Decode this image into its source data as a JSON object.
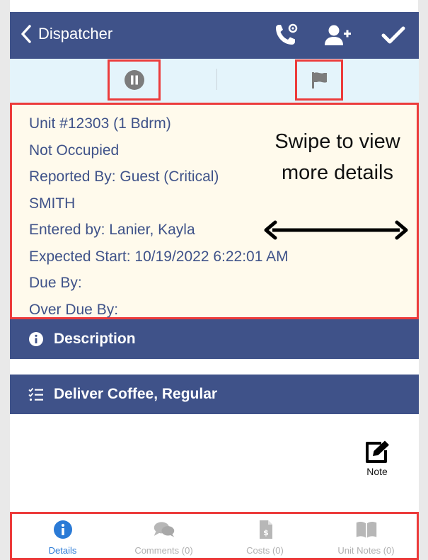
{
  "header": {
    "back_label": "Dispatcher",
    "icons": [
      "phone-icon",
      "add-user-icon",
      "checkmark-icon"
    ]
  },
  "status_bar": {
    "pause_icon": "pause-icon",
    "flag_icon": "flag-icon"
  },
  "details": {
    "lines": [
      "Unit #12303 (1 Bdrm)",
      "Not Occupied",
      "Reported By: Guest  (Critical)",
      "SMITH",
      "Entered by: Lanier, Kayla",
      "Expected Start: 10/19/2022 6:22:01 AM",
      "Due By:",
      "Over Due By:"
    ],
    "hint": "Swipe to view more details"
  },
  "description": {
    "title": "Description",
    "icon": "info-icon"
  },
  "task": {
    "title": "Deliver Coffee, Regular",
    "icon": "checklist-icon"
  },
  "note": {
    "label": "Note",
    "icon": "edit-icon"
  },
  "tabs": [
    {
      "label": "Details",
      "icon": "info-icon",
      "active": true
    },
    {
      "label": "Comments (0)",
      "icon": "comments-icon",
      "active": false
    },
    {
      "label": "Costs (0)",
      "icon": "invoice-icon",
      "active": false
    },
    {
      "label": "Unit Notes (0)",
      "icon": "book-icon",
      "active": false
    }
  ],
  "colors": {
    "header_bg": "#3f5289",
    "strip_bg": "#e4f4fb",
    "details_bg": "#fffaec",
    "highlight": "#ec3b3b",
    "active_tab": "#2a7ad6",
    "inactive_tab": "#b0b0b0"
  }
}
